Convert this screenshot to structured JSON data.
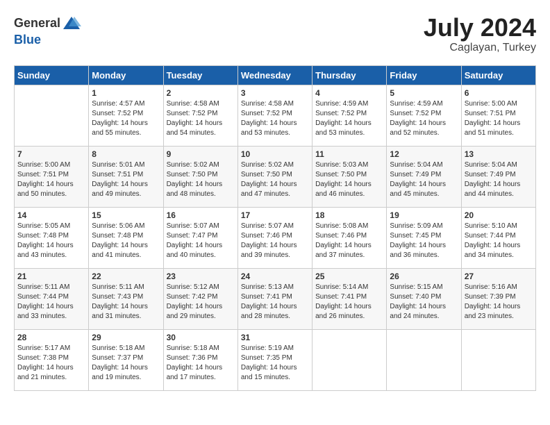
{
  "header": {
    "logo_general": "General",
    "logo_blue": "Blue",
    "month_year": "July 2024",
    "location": "Caglayan, Turkey"
  },
  "weekdays": [
    "Sunday",
    "Monday",
    "Tuesday",
    "Wednesday",
    "Thursday",
    "Friday",
    "Saturday"
  ],
  "weeks": [
    [
      {
        "day": "",
        "sunrise": "",
        "sunset": "",
        "daylight": ""
      },
      {
        "day": "1",
        "sunrise": "Sunrise: 4:57 AM",
        "sunset": "Sunset: 7:52 PM",
        "daylight": "Daylight: 14 hours and 55 minutes."
      },
      {
        "day": "2",
        "sunrise": "Sunrise: 4:58 AM",
        "sunset": "Sunset: 7:52 PM",
        "daylight": "Daylight: 14 hours and 54 minutes."
      },
      {
        "day": "3",
        "sunrise": "Sunrise: 4:58 AM",
        "sunset": "Sunset: 7:52 PM",
        "daylight": "Daylight: 14 hours and 53 minutes."
      },
      {
        "day": "4",
        "sunrise": "Sunrise: 4:59 AM",
        "sunset": "Sunset: 7:52 PM",
        "daylight": "Daylight: 14 hours and 53 minutes."
      },
      {
        "day": "5",
        "sunrise": "Sunrise: 4:59 AM",
        "sunset": "Sunset: 7:52 PM",
        "daylight": "Daylight: 14 hours and 52 minutes."
      },
      {
        "day": "6",
        "sunrise": "Sunrise: 5:00 AM",
        "sunset": "Sunset: 7:51 PM",
        "daylight": "Daylight: 14 hours and 51 minutes."
      }
    ],
    [
      {
        "day": "7",
        "sunrise": "Sunrise: 5:00 AM",
        "sunset": "Sunset: 7:51 PM",
        "daylight": "Daylight: 14 hours and 50 minutes."
      },
      {
        "day": "8",
        "sunrise": "Sunrise: 5:01 AM",
        "sunset": "Sunset: 7:51 PM",
        "daylight": "Daylight: 14 hours and 49 minutes."
      },
      {
        "day": "9",
        "sunrise": "Sunrise: 5:02 AM",
        "sunset": "Sunset: 7:50 PM",
        "daylight": "Daylight: 14 hours and 48 minutes."
      },
      {
        "day": "10",
        "sunrise": "Sunrise: 5:02 AM",
        "sunset": "Sunset: 7:50 PM",
        "daylight": "Daylight: 14 hours and 47 minutes."
      },
      {
        "day": "11",
        "sunrise": "Sunrise: 5:03 AM",
        "sunset": "Sunset: 7:50 PM",
        "daylight": "Daylight: 14 hours and 46 minutes."
      },
      {
        "day": "12",
        "sunrise": "Sunrise: 5:04 AM",
        "sunset": "Sunset: 7:49 PM",
        "daylight": "Daylight: 14 hours and 45 minutes."
      },
      {
        "day": "13",
        "sunrise": "Sunrise: 5:04 AM",
        "sunset": "Sunset: 7:49 PM",
        "daylight": "Daylight: 14 hours and 44 minutes."
      }
    ],
    [
      {
        "day": "14",
        "sunrise": "Sunrise: 5:05 AM",
        "sunset": "Sunset: 7:48 PM",
        "daylight": "Daylight: 14 hours and 43 minutes."
      },
      {
        "day": "15",
        "sunrise": "Sunrise: 5:06 AM",
        "sunset": "Sunset: 7:48 PM",
        "daylight": "Daylight: 14 hours and 41 minutes."
      },
      {
        "day": "16",
        "sunrise": "Sunrise: 5:07 AM",
        "sunset": "Sunset: 7:47 PM",
        "daylight": "Daylight: 14 hours and 40 minutes."
      },
      {
        "day": "17",
        "sunrise": "Sunrise: 5:07 AM",
        "sunset": "Sunset: 7:46 PM",
        "daylight": "Daylight: 14 hours and 39 minutes."
      },
      {
        "day": "18",
        "sunrise": "Sunrise: 5:08 AM",
        "sunset": "Sunset: 7:46 PM",
        "daylight": "Daylight: 14 hours and 37 minutes."
      },
      {
        "day": "19",
        "sunrise": "Sunrise: 5:09 AM",
        "sunset": "Sunset: 7:45 PM",
        "daylight": "Daylight: 14 hours and 36 minutes."
      },
      {
        "day": "20",
        "sunrise": "Sunrise: 5:10 AM",
        "sunset": "Sunset: 7:44 PM",
        "daylight": "Daylight: 14 hours and 34 minutes."
      }
    ],
    [
      {
        "day": "21",
        "sunrise": "Sunrise: 5:11 AM",
        "sunset": "Sunset: 7:44 PM",
        "daylight": "Daylight: 14 hours and 33 minutes."
      },
      {
        "day": "22",
        "sunrise": "Sunrise: 5:11 AM",
        "sunset": "Sunset: 7:43 PM",
        "daylight": "Daylight: 14 hours and 31 minutes."
      },
      {
        "day": "23",
        "sunrise": "Sunrise: 5:12 AM",
        "sunset": "Sunset: 7:42 PM",
        "daylight": "Daylight: 14 hours and 29 minutes."
      },
      {
        "day": "24",
        "sunrise": "Sunrise: 5:13 AM",
        "sunset": "Sunset: 7:41 PM",
        "daylight": "Daylight: 14 hours and 28 minutes."
      },
      {
        "day": "25",
        "sunrise": "Sunrise: 5:14 AM",
        "sunset": "Sunset: 7:41 PM",
        "daylight": "Daylight: 14 hours and 26 minutes."
      },
      {
        "day": "26",
        "sunrise": "Sunrise: 5:15 AM",
        "sunset": "Sunset: 7:40 PM",
        "daylight": "Daylight: 14 hours and 24 minutes."
      },
      {
        "day": "27",
        "sunrise": "Sunrise: 5:16 AM",
        "sunset": "Sunset: 7:39 PM",
        "daylight": "Daylight: 14 hours and 23 minutes."
      }
    ],
    [
      {
        "day": "28",
        "sunrise": "Sunrise: 5:17 AM",
        "sunset": "Sunset: 7:38 PM",
        "daylight": "Daylight: 14 hours and 21 minutes."
      },
      {
        "day": "29",
        "sunrise": "Sunrise: 5:18 AM",
        "sunset": "Sunset: 7:37 PM",
        "daylight": "Daylight: 14 hours and 19 minutes."
      },
      {
        "day": "30",
        "sunrise": "Sunrise: 5:18 AM",
        "sunset": "Sunset: 7:36 PM",
        "daylight": "Daylight: 14 hours and 17 minutes."
      },
      {
        "day": "31",
        "sunrise": "Sunrise: 5:19 AM",
        "sunset": "Sunset: 7:35 PM",
        "daylight": "Daylight: 14 hours and 15 minutes."
      },
      {
        "day": "",
        "sunrise": "",
        "sunset": "",
        "daylight": ""
      },
      {
        "day": "",
        "sunrise": "",
        "sunset": "",
        "daylight": ""
      },
      {
        "day": "",
        "sunrise": "",
        "sunset": "",
        "daylight": ""
      }
    ]
  ]
}
